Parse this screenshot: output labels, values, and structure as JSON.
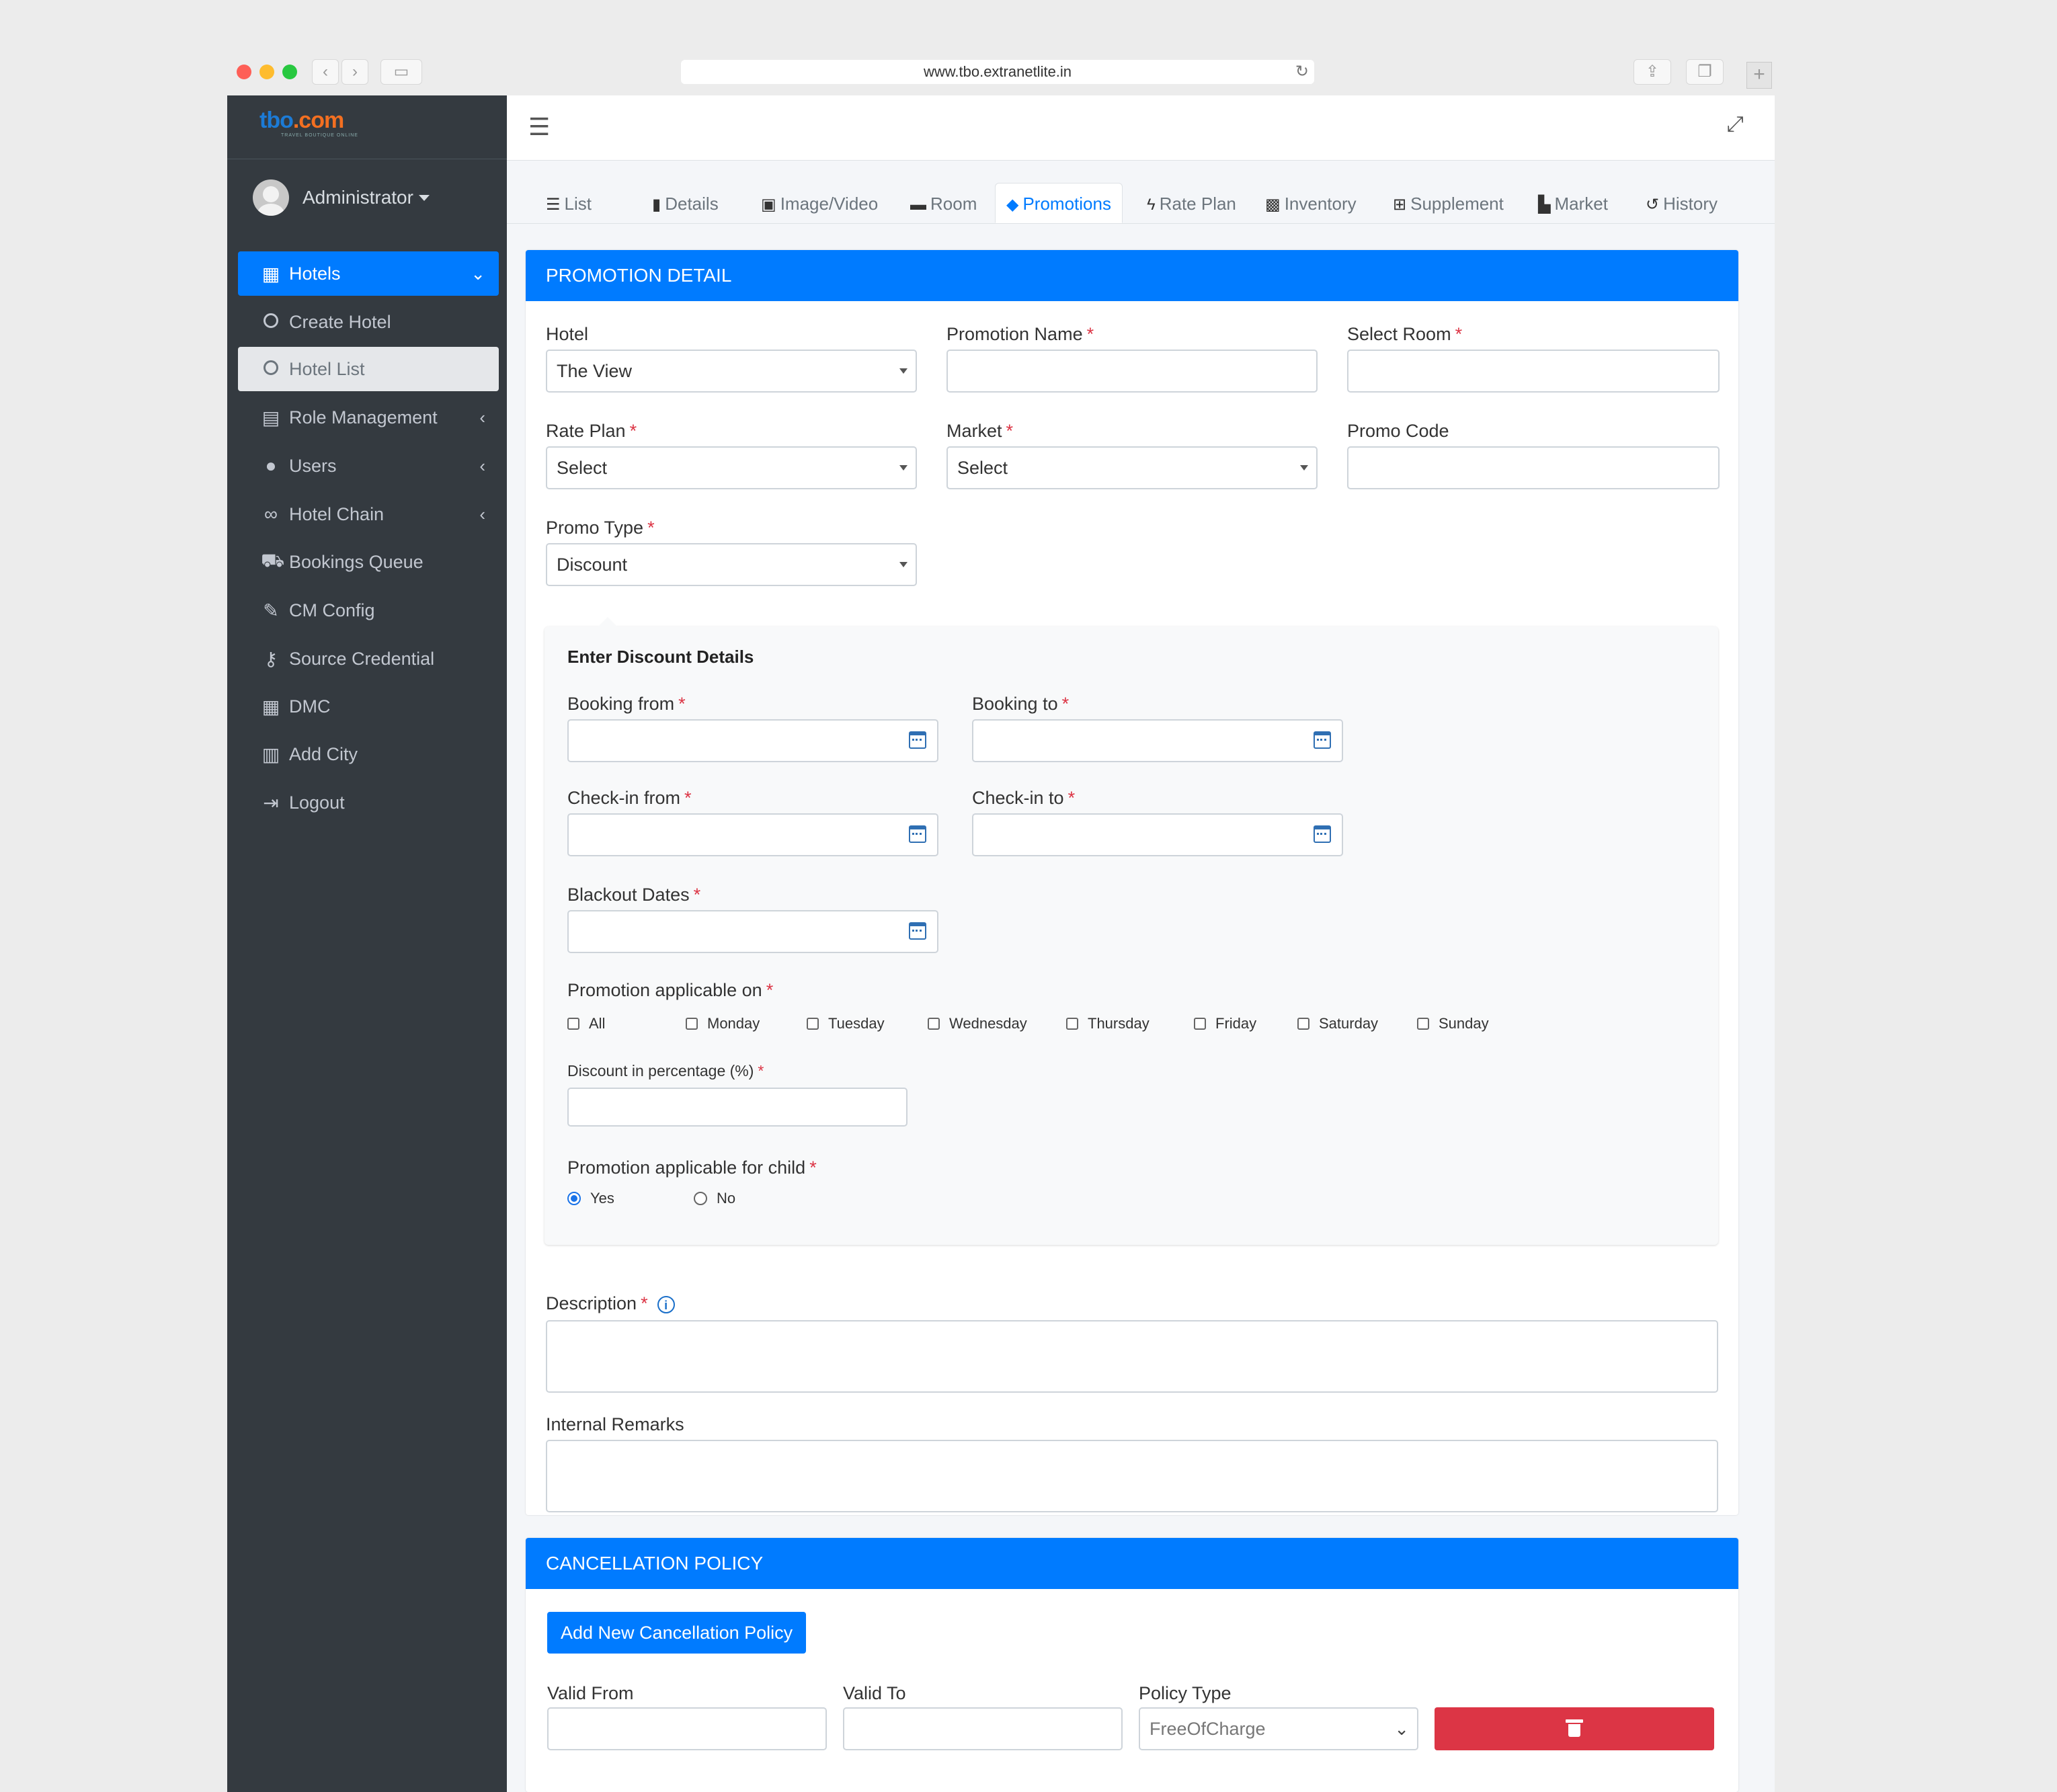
{
  "browser": {
    "url": "www.tbo.extranetlite.in",
    "traffic_lights": [
      "#fe5f57",
      "#febc2e",
      "#28c840"
    ]
  },
  "brand": {
    "logo_main": "tbo",
    "logo_dot": ".com",
    "logo_sub": "TRAVEL BOUTIQUE ONLINE"
  },
  "user": {
    "name": "Administrator"
  },
  "sidebar": {
    "items": [
      {
        "label": "Hotels",
        "icon": "building-icon"
      },
      {
        "label": "Create Hotel",
        "icon": "circle-icon"
      },
      {
        "label": "Hotel List",
        "icon": "circle-icon"
      },
      {
        "label": "Role Management",
        "icon": "clipboard-icon"
      },
      {
        "label": "Users",
        "icon": "user-icon"
      },
      {
        "label": "Hotel Chain",
        "icon": "link-icon"
      },
      {
        "label": "Bookings Queue",
        "icon": "cart-icon"
      },
      {
        "label": "CM Config",
        "icon": "brush-icon"
      },
      {
        "label": "Source Credential",
        "icon": "key-icon"
      },
      {
        "label": "DMC",
        "icon": "building-icon"
      },
      {
        "label": "Add City",
        "icon": "city-icon"
      },
      {
        "label": "Logout",
        "icon": "sign-out-icon"
      }
    ]
  },
  "tabs": [
    "List",
    "Details",
    "Image/Video",
    "Room",
    "Promotions",
    "Rate Plan",
    "Inventory",
    "Supplement",
    "Market",
    "History"
  ],
  "active_tab": "Promotions",
  "promotion": {
    "header": "PROMOTION DETAIL",
    "hotel_label": "Hotel",
    "hotel_value": "The View",
    "promotion_name_label": "Promotion Name",
    "select_room_label": "Select Room",
    "rate_plan_label": "Rate Plan",
    "rate_plan_value": "Select",
    "market_label": "Market",
    "market_value": "Select",
    "promo_code_label": "Promo Code",
    "promo_type_label": "Promo Type",
    "promo_type_value": "Discount",
    "required_mark": "*"
  },
  "discount": {
    "title": "Enter Discount Details",
    "booking_from": "Booking from",
    "booking_to": "Booking to",
    "checkin_from": "Check-in from",
    "checkin_to": "Check-in to",
    "blackout": "Blackout Dates",
    "applicable_on": "Promotion applicable on",
    "days": [
      "All",
      "Monday",
      "Tuesday",
      "Wednesday",
      "Thursday",
      "Friday",
      "Saturday",
      "Sunday"
    ],
    "percentage_label": "Discount in percentage (%)",
    "child_label": "Promotion applicable for child",
    "child_options": [
      "Yes",
      "No"
    ],
    "child_selected": "Yes"
  },
  "description_label": "Description",
  "info_glyph": "i",
  "internal_remarks_label": "Internal Remarks",
  "cancellation": {
    "header": "CANCELLATION POLICY",
    "add_button": "Add New Cancellation Policy",
    "valid_from": "Valid From",
    "valid_to": "Valid To",
    "policy_type": "Policy Type",
    "policy_type_value": "FreeOfCharge"
  },
  "colors": {
    "primary": "#007bff",
    "danger": "#dc3545",
    "sidebar": "#343a40"
  }
}
